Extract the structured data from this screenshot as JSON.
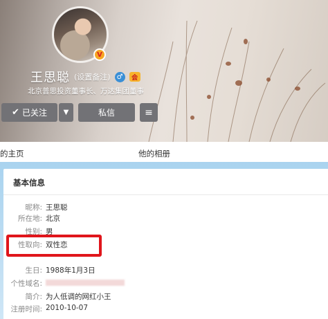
{
  "profile": {
    "name": "王思聪",
    "remark": "(设置备注)",
    "gender_symbol": "♂",
    "verify_badge": "V",
    "vip_badge": "会",
    "bio": "北京普思投资董事长、万达集团董事"
  },
  "actions": {
    "follow_label": "已关注",
    "follow_check": "✔",
    "dropdown_symbol": "▼",
    "message_label": "私信",
    "menu_symbol": "≡"
  },
  "tabs": {
    "home": "的主页",
    "album": "他的相册"
  },
  "info": {
    "title": "基本信息",
    "rows": [
      {
        "label": "昵称:",
        "value": "王思聪"
      },
      {
        "label": "所在地:",
        "value": "北京"
      },
      {
        "label": "性别:",
        "value": "男"
      },
      {
        "label": "性取向:",
        "value": "双性恋"
      },
      {
        "label": "",
        "value": ""
      },
      {
        "label": "生日:",
        "value": "1988年1月3日"
      },
      {
        "label": "个性域名:",
        "value": ""
      },
      {
        "label": "简介:",
        "value": "为人低调的网红小王"
      },
      {
        "label": "注册时间:",
        "value": "2010-10-07"
      }
    ]
  },
  "colors": {
    "highlight_border": "#e0151b",
    "button_bg": "#727276",
    "gender_blue": "#3a8fd6"
  }
}
